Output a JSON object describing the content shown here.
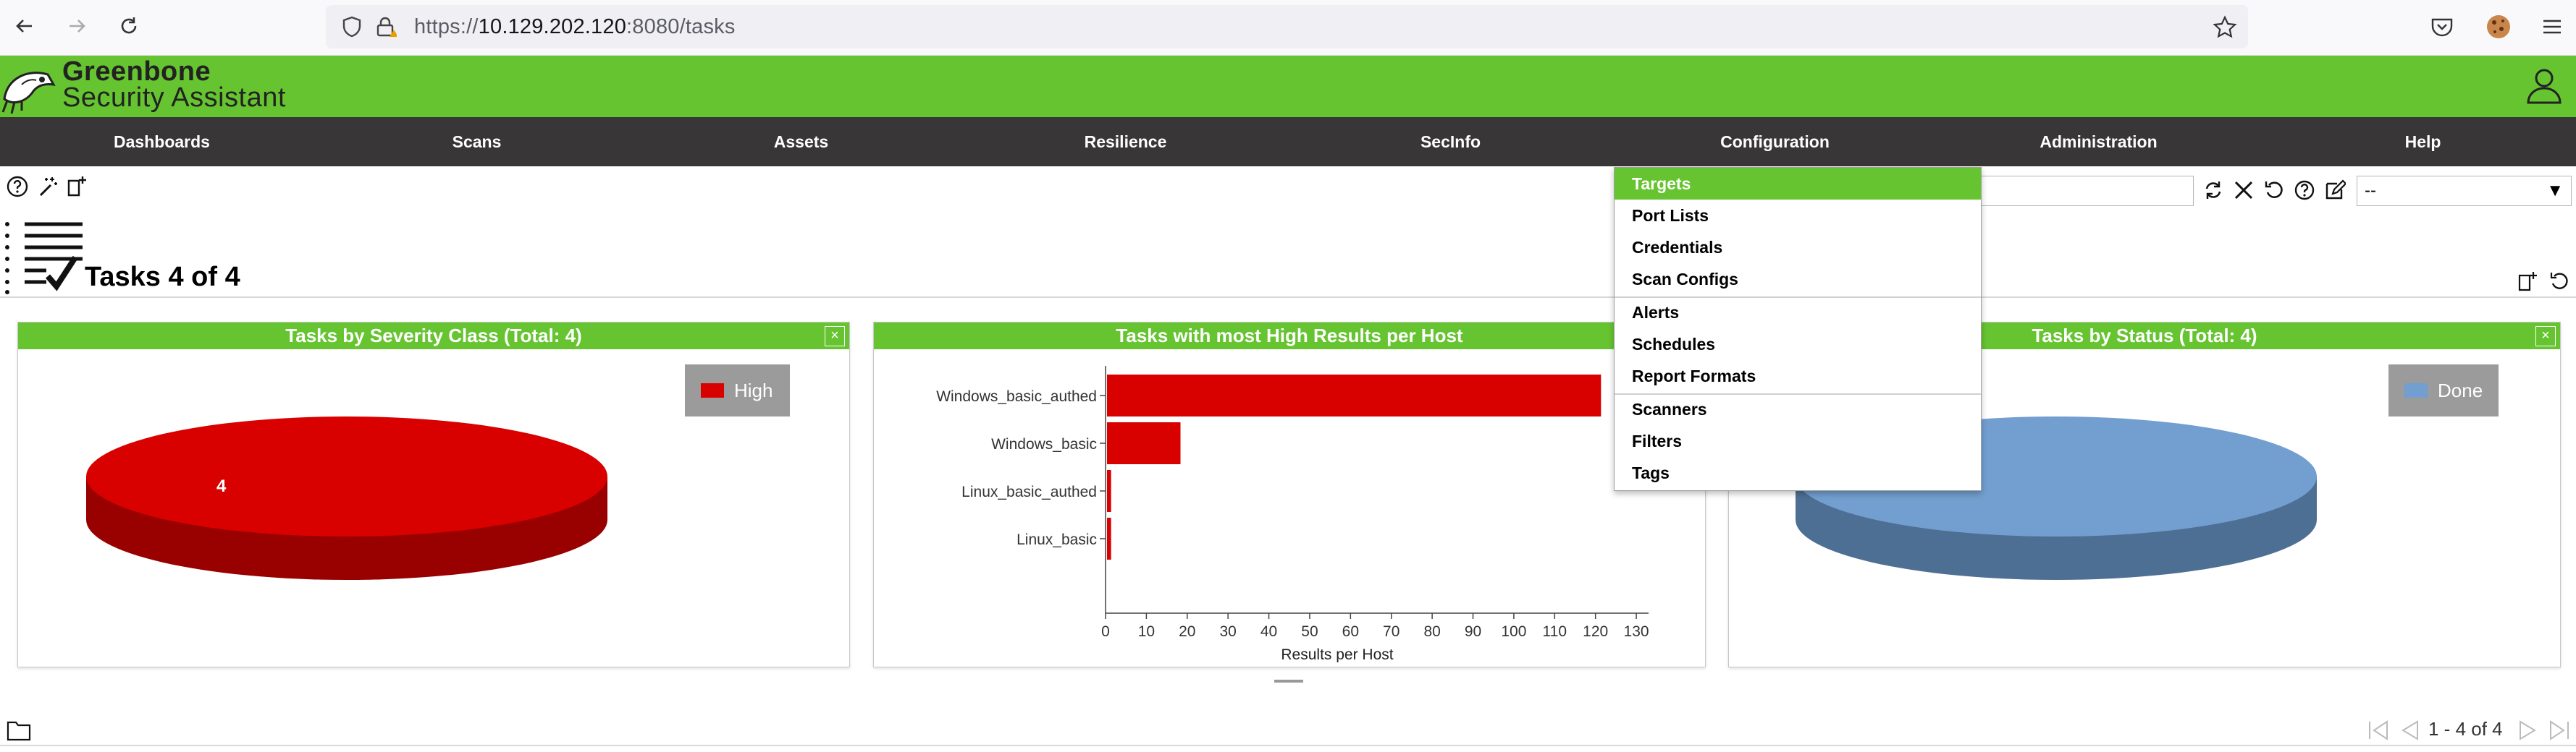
{
  "browser": {
    "url_scheme": "https://",
    "url_host": "10.129.202.120",
    "url_rest": ":8080/tasks"
  },
  "brand": {
    "line1": "Greenbone",
    "line2": "Security Assistant"
  },
  "menu": [
    "Dashboards",
    "Scans",
    "Assets",
    "Resilience",
    "SecInfo",
    "Configuration",
    "Administration",
    "Help"
  ],
  "config_dropdown": {
    "items": [
      "Targets",
      "Port Lists",
      "Credentials",
      "Scan Configs",
      "Alerts",
      "Schedules",
      "Report Formats",
      "Scanners",
      "Filters",
      "Tags"
    ],
    "active": "Targets"
  },
  "filter": {
    "value": "",
    "select_value": "--"
  },
  "page": {
    "title": "Tasks 4 of 4",
    "pager": "1 - 4 of 4"
  },
  "panels": {
    "severity": {
      "title": "Tasks by Severity Class (Total: 4)",
      "legend": "High",
      "slice_label": "4",
      "color": "#d90000"
    },
    "high_results": {
      "title": "Tasks with most High Results per Host",
      "xlabel": "Results per Host"
    },
    "status": {
      "title": "Tasks by Status (Total: 4)",
      "legend": "Done",
      "color": "#729fcf"
    }
  },
  "chart_data": [
    {
      "type": "pie",
      "title": "Tasks by Severity Class (Total: 4)",
      "labels": [
        "High"
      ],
      "values": [
        4
      ],
      "colors": [
        "#d90000"
      ]
    },
    {
      "type": "bar",
      "orientation": "horizontal",
      "title": "Tasks with most High Results per Host",
      "categories": [
        "Windows_basic_authed",
        "Windows_basic",
        "Linux_basic_authed",
        "Linux_basic"
      ],
      "values": [
        121,
        18,
        1,
        1
      ],
      "xlabel": "Results per Host",
      "xlim": [
        0,
        133
      ],
      "xticks": [
        0,
        10,
        20,
        30,
        40,
        50,
        60,
        70,
        80,
        90,
        100,
        110,
        120,
        130
      ],
      "color": "#d90000"
    },
    {
      "type": "pie",
      "title": "Tasks by Status (Total: 4)",
      "labels": [
        "Done"
      ],
      "values": [
        4
      ],
      "colors": [
        "#729fcf"
      ]
    }
  ]
}
